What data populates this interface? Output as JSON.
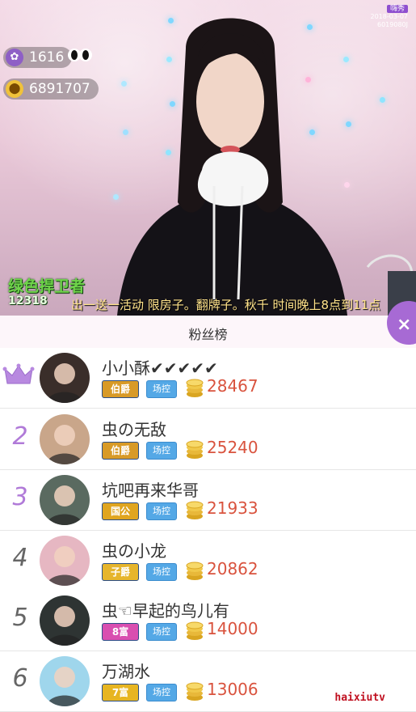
{
  "video": {
    "viewers": "1616",
    "coins_total": "6891707",
    "app_badge": "嗨秀",
    "app_date": "2018-03-07",
    "app_id": "6019080J",
    "tv_logo_text": "绿色捍卫者",
    "tv_logo_num": "12318",
    "ticker": "出一送一活动 限房子。翻牌子。秋千 时间晚上8点到11点"
  },
  "panel": {
    "title": "粉丝榜",
    "close_icon": "×"
  },
  "fans": [
    {
      "rank": "",
      "name": "小小酥✔✔✔✔✔",
      "tag": "伯爵",
      "tag_color": "#d89a27",
      "field": "场控",
      "coins": "28467",
      "avatar_color": "#3a2e2a"
    },
    {
      "rank": "2",
      "name": "虫の无敌",
      "tag": "伯爵",
      "tag_color": "#d89a27",
      "field": "场控",
      "coins": "25240",
      "avatar_color": "#c9a68a"
    },
    {
      "rank": "3",
      "name": "坑吧再来华哥",
      "tag": "国公",
      "tag_color": "#e0a51f",
      "field": "场控",
      "coins": "21933",
      "avatar_color": "#5a6a60"
    },
    {
      "rank": "4",
      "name": "虫の小龙",
      "tag": "子爵",
      "tag_color": "#e6b52c",
      "field": "场控",
      "coins": "20862",
      "avatar_color": "#e6b7c2"
    },
    {
      "rank": "5",
      "name": "虫☜早起的鸟儿有",
      "tag": "8富",
      "tag_color": "#d94fb0",
      "field": "场控",
      "coins": "14000",
      "avatar_color": "#2e3433"
    },
    {
      "rank": "6",
      "name": "万湖水",
      "tag": "7富",
      "tag_color": "#e7b521",
      "field": "场控",
      "coins": "13006",
      "avatar_color": "#9fd6ec"
    }
  ],
  "watermark": "haixiutv"
}
